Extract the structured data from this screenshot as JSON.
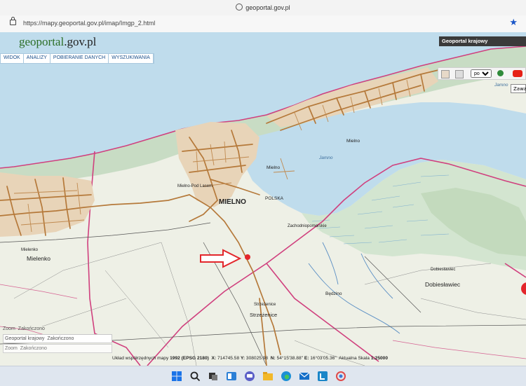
{
  "browser": {
    "title": "geoportal.gov.pl",
    "url": "https://mapy.geoportal.gov.pl/imap/Imgp_2.html"
  },
  "logo": {
    "part1": "geo",
    "part2": "portal",
    "part3": ".gov.pl"
  },
  "menu": [
    "WIDOK",
    "ANALIZY",
    "POBIERANIE DANYCH",
    "WYSZUKIWANIA"
  ],
  "header_panel": {
    "title": "Geoportal krajowy"
  },
  "toolbar": {
    "lang": "pol",
    "lang_options": [
      "pol"
    ],
    "zawa": "Zawa"
  },
  "map_labels": {
    "mielno_town": "MIELNO",
    "mielno_village": "Mielno",
    "mielno_lake": "Mielno",
    "jamno1": "Jamno",
    "jamno2": "Jamno",
    "mielno_label_small": "Mielno-Pod Lasem",
    "polska": "POLSKA",
    "zachodniopomorskie": "Zachodniopomorskie",
    "mielenko1": "Mielenko",
    "mielenko2": "Mielenko",
    "doblestawiec1": "Dobiesławiec",
    "doblestawiec2": "Dobiesławiec",
    "bedzino": "Będzino",
    "strzeznice1": "Strzeżenice",
    "strzeznice2": "Strzeżenice"
  },
  "zoom_controls": {
    "zoom_label": "Zoom",
    "finish_label": "Zakończono",
    "geoportal_label": "Geoportal krajowy",
    "finish_label2": "Zakończono",
    "zoom_label2": "Zoom",
    "finish_label3": "Zakończono"
  },
  "status": {
    "prefix": "Układ współrzędnych mapy",
    "crs": "1992 (EPSG 2180)",
    "x_label": "X:",
    "x_value": "714745.58",
    "y_label": "Y:",
    "y_value": "308025.98",
    "n_label": "N:",
    "n_value": "54°15'38.88\"",
    "e_label": "E:",
    "e_value": "16°03'05.36\"",
    "scale_label": "Aktualna Skala",
    "scale_value": "1:25000"
  },
  "colors": {
    "sea": "#bfdcec",
    "land": "#eef0e6",
    "forest": "#c8dcc4",
    "road": "#b5793a",
    "boundary": "#d0407e",
    "marker": "#e3262b"
  },
  "taskbar_icons": [
    "windows-icon",
    "search-icon",
    "task-view-icon",
    "widgets-icon",
    "chat-icon",
    "file-explorer-icon",
    "edge-icon",
    "mail-icon",
    "app-l-icon",
    "app-photo-icon"
  ]
}
